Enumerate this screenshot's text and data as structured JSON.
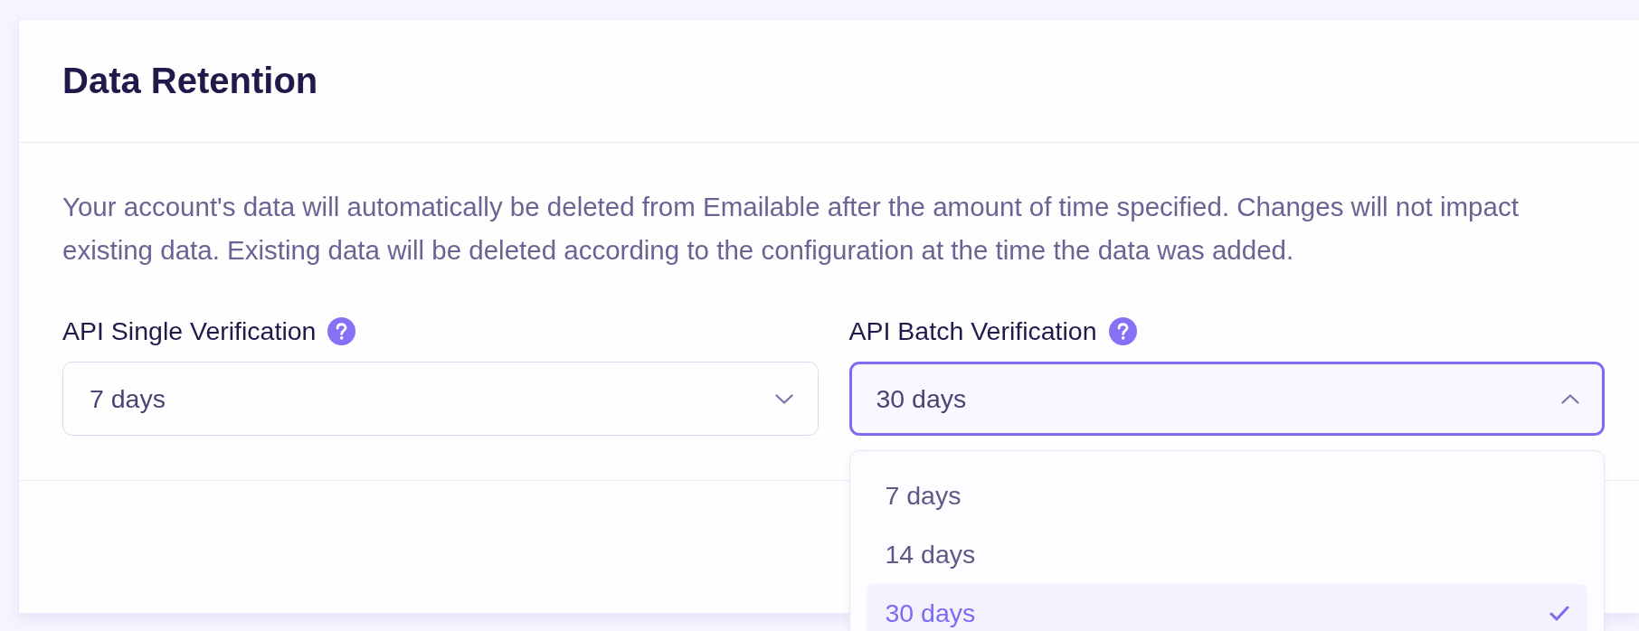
{
  "card": {
    "title": "Data Retention",
    "description": "Your account's data will automatically be deleted from Emailable after the amount of time specified. Changes will not impact existing data. Existing data will be deleted according to the configuration at the time the data was added.",
    "fields": [
      {
        "label": "API Single Verification",
        "value": "7 days",
        "expanded": false
      },
      {
        "label": "API Batch Verification",
        "value": "30 days",
        "expanded": true,
        "options": [
          {
            "label": "7 days",
            "selected": false
          },
          {
            "label": "14 days",
            "selected": false
          },
          {
            "label": "30 days",
            "selected": true
          }
        ]
      }
    ]
  }
}
